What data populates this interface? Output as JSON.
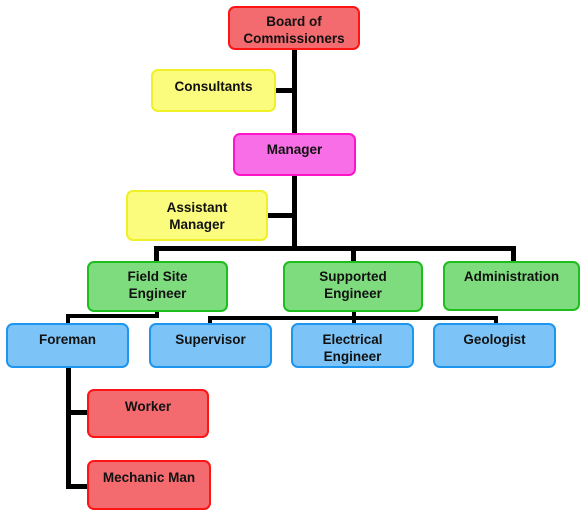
{
  "diagram": {
    "type": "org-chart",
    "nodes": {
      "board": {
        "label": "Board of Commissioners",
        "line1": "Board of",
        "line2": "Commissioners",
        "color": "#f36a6f"
      },
      "consultants": {
        "label": "Consultants",
        "color": "#fbfb7e"
      },
      "manager": {
        "label": "Manager",
        "color": "#f76ee6"
      },
      "assistant_manager": {
        "label": "Assistant Manager",
        "line1": "Assistant",
        "line2": "Manager",
        "color": "#fbfb7e"
      },
      "field_site_engineer": {
        "label": "Field Site Engineer",
        "line1": "Field Site",
        "line2": "Engineer",
        "color": "#7fdc7e"
      },
      "supported_engineer": {
        "label": "Supported Engineer",
        "line1": "Supported",
        "line2": "Engineer",
        "color": "#7fdc7e"
      },
      "administration": {
        "label": "Administration",
        "color": "#7fdc7e"
      },
      "foreman": {
        "label": "Foreman",
        "color": "#7cc4f7"
      },
      "supervisor": {
        "label": "Supervisor",
        "color": "#7cc4f7"
      },
      "electrical_engineer": {
        "label": "Electrical Engineer",
        "line1": "Electrical",
        "line2": "Engineer",
        "color": "#7cc4f7"
      },
      "geologist": {
        "label": "Geologist",
        "color": "#7cc4f7"
      },
      "worker": {
        "label": "Worker",
        "color": "#f36a6f"
      },
      "mechanic_man": {
        "label": "Mechanic Man",
        "color": "#f36a6f"
      }
    },
    "edges": [
      [
        "board",
        "consultants"
      ],
      [
        "board",
        "manager"
      ],
      [
        "manager",
        "assistant_manager"
      ],
      [
        "manager",
        "field_site_engineer"
      ],
      [
        "manager",
        "supported_engineer"
      ],
      [
        "manager",
        "administration"
      ],
      [
        "field_site_engineer",
        "foreman"
      ],
      [
        "supported_engineer",
        "supervisor"
      ],
      [
        "supported_engineer",
        "electrical_engineer"
      ],
      [
        "supported_engineer",
        "geologist"
      ],
      [
        "foreman",
        "worker"
      ],
      [
        "foreman",
        "mechanic_man"
      ]
    ]
  }
}
